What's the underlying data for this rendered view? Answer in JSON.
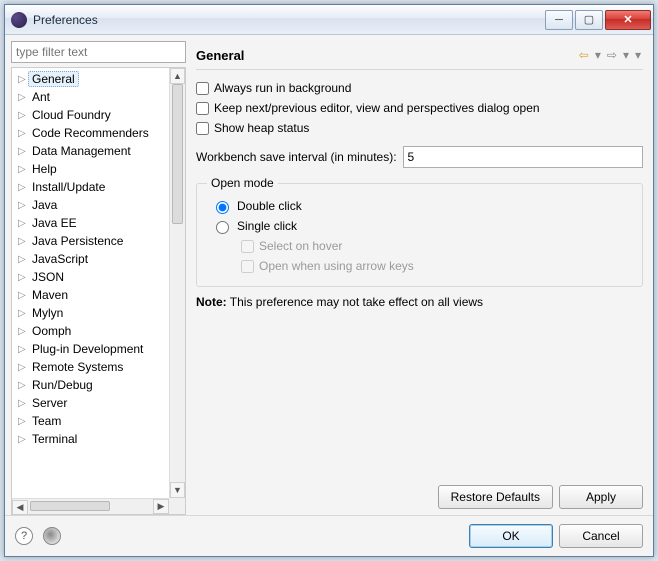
{
  "window": {
    "title": "Preferences"
  },
  "filter": {
    "placeholder": "type filter text"
  },
  "tree": {
    "items": [
      "General",
      "Ant",
      "Cloud Foundry",
      "Code Recommenders",
      "Data Management",
      "Help",
      "Install/Update",
      "Java",
      "Java EE",
      "Java Persistence",
      "JavaScript",
      "JSON",
      "Maven",
      "Mylyn",
      "Oomph",
      "Plug-in Development",
      "Remote Systems",
      "Run/Debug",
      "Server",
      "Team",
      "Terminal"
    ],
    "selected_index": 0
  },
  "page": {
    "title": "General",
    "checkboxes": {
      "run_bg": "Always run in background",
      "keep_dialog": "Keep next/previous editor, view and perspectives dialog open",
      "heap": "Show heap status"
    },
    "save_interval": {
      "label": "Workbench save interval (in minutes):",
      "value": "5"
    },
    "open_mode": {
      "legend": "Open mode",
      "double": "Double click",
      "single": "Single click",
      "select_hover": "Select on hover",
      "open_arrow": "Open when using arrow keys"
    },
    "note_label": "Note:",
    "note_text": "This preference may not take effect on all views"
  },
  "buttons": {
    "restore": "Restore Defaults",
    "apply": "Apply",
    "ok": "OK",
    "cancel": "Cancel"
  }
}
